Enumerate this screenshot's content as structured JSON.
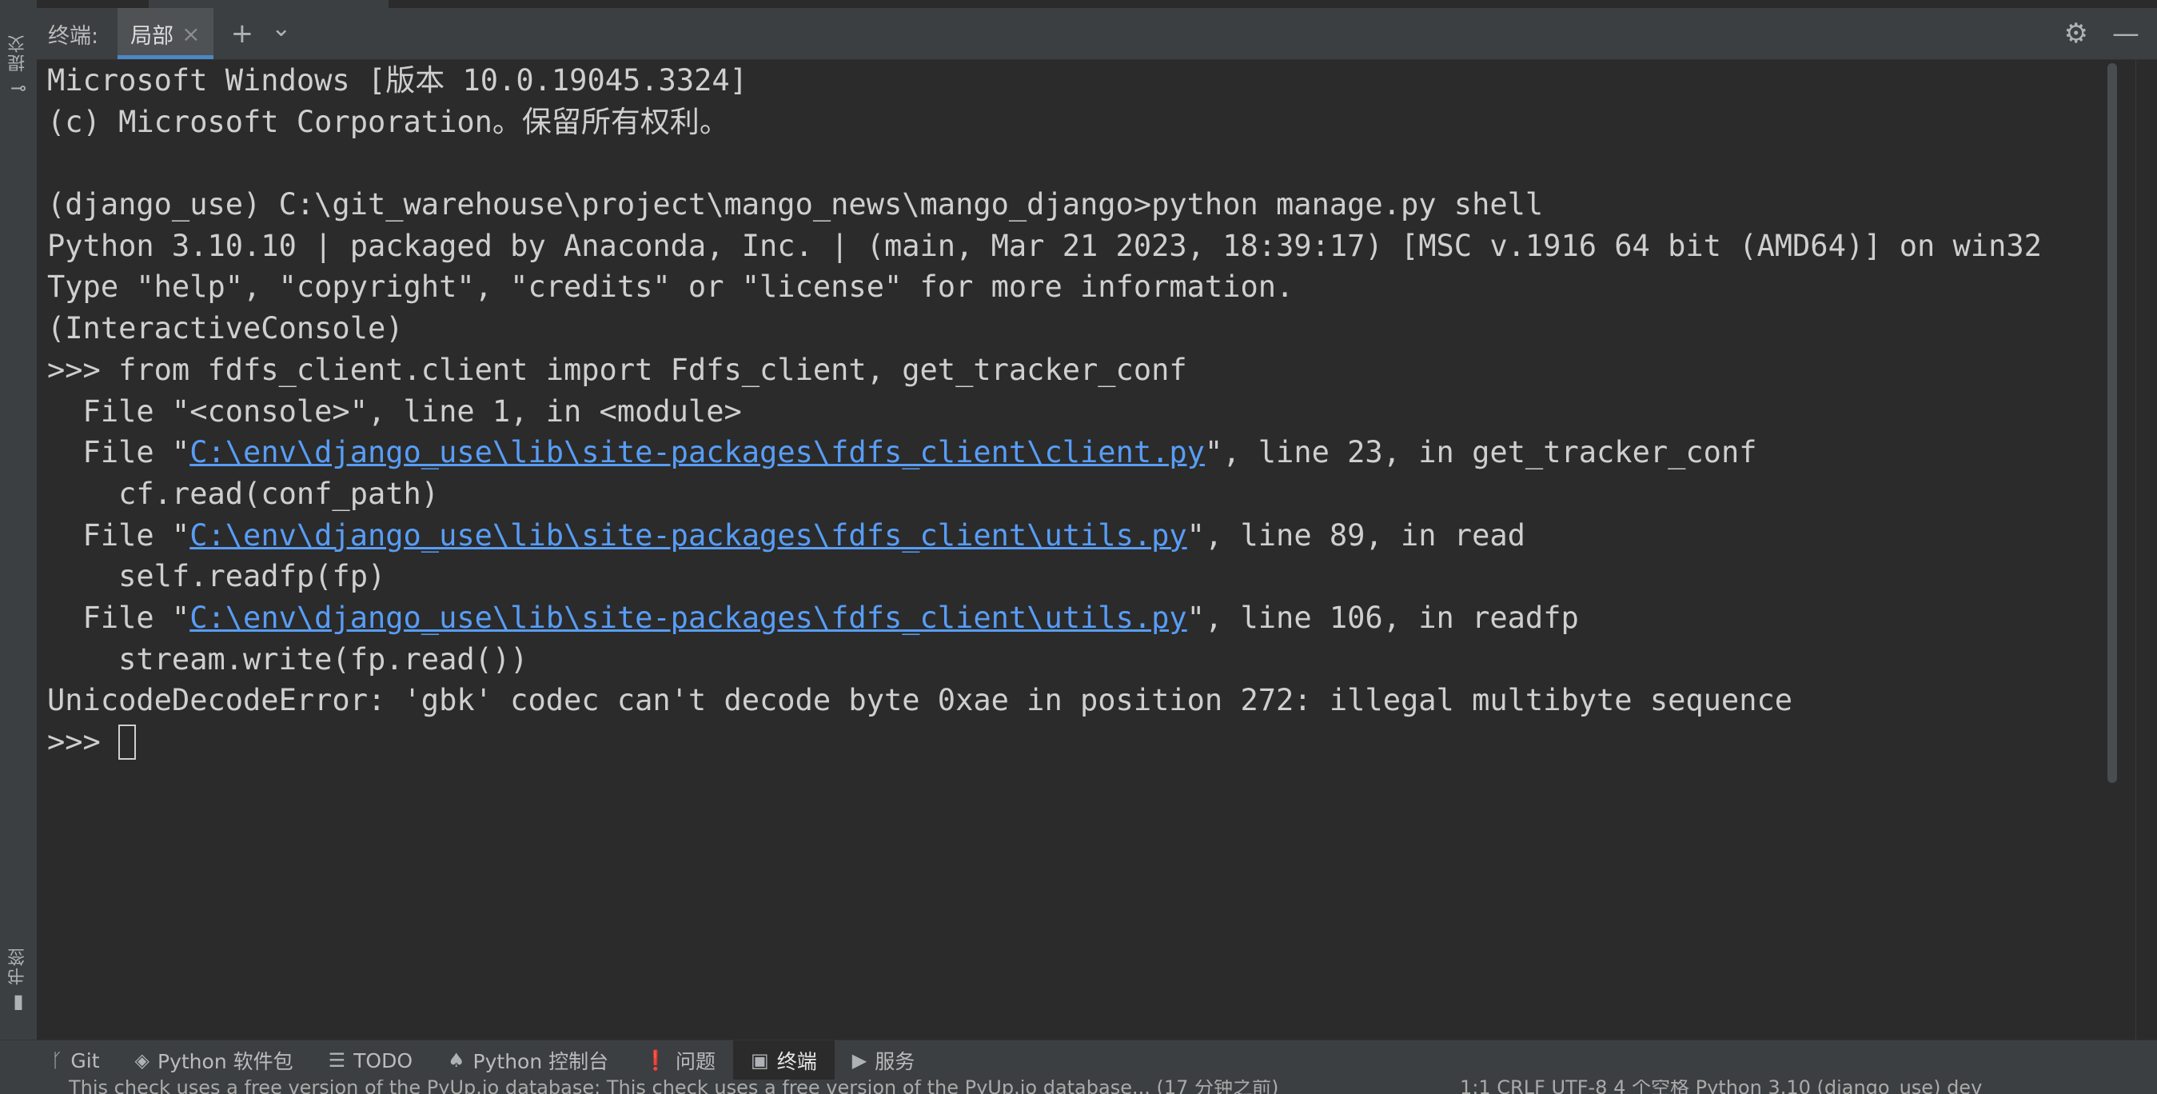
{
  "left_strip": {
    "commit_label": "提交",
    "bookmarks_label": "书签"
  },
  "terminal_header": {
    "title": "终端:",
    "tab_label": "局部",
    "close_glyph": "×",
    "add_glyph": "+",
    "dropdown_glyph": "⌄",
    "settings_glyph": "⚙",
    "minimize_glyph": "—"
  },
  "terminal": {
    "lines": [
      {
        "parts": [
          {
            "text": "Microsoft Windows [版本 10.0.19045.3324]"
          }
        ]
      },
      {
        "parts": [
          {
            "text": "(c) Microsoft Corporation。保留所有权利。"
          }
        ]
      },
      {
        "parts": [
          {
            "text": ""
          }
        ]
      },
      {
        "parts": [
          {
            "text": "(django_use) C:\\git_warehouse\\project\\mango_news\\mango_django>python manage.py shell"
          }
        ]
      },
      {
        "parts": [
          {
            "text": "Python 3.10.10 | packaged by Anaconda, Inc. | (main, Mar 21 2023, 18:39:17) [MSC v.1916 64 bit (AMD64)] on win32"
          }
        ]
      },
      {
        "parts": [
          {
            "text": "Type \"help\", \"copyright\", \"credits\" or \"license\" for more information."
          }
        ]
      },
      {
        "parts": [
          {
            "text": "(InteractiveConsole)"
          }
        ]
      },
      {
        "parts": [
          {
            "text": ">>> from fdfs_client.client import Fdfs_client, get_tracker_conf"
          }
        ]
      },
      {
        "parts": [
          {
            "text": "  File \"<console>\", line 1, in <module>"
          }
        ]
      },
      {
        "parts": [
          {
            "text": "  File \""
          },
          {
            "text": "C:\\env\\django_use\\lib\\site-packages\\fdfs_client\\client.py",
            "link": true
          },
          {
            "text": "\", line 23, in get_tracker_conf"
          }
        ]
      },
      {
        "parts": [
          {
            "text": "    cf.read(conf_path)"
          }
        ]
      },
      {
        "parts": [
          {
            "text": "  File \""
          },
          {
            "text": "C:\\env\\django_use\\lib\\site-packages\\fdfs_client\\utils.py",
            "link": true
          },
          {
            "text": "\", line 89, in read"
          }
        ]
      },
      {
        "parts": [
          {
            "text": "    self.readfp(fp)"
          }
        ]
      },
      {
        "parts": [
          {
            "text": "  File \""
          },
          {
            "text": "C:\\env\\django_use\\lib\\site-packages\\fdfs_client\\utils.py",
            "link": true
          },
          {
            "text": "\", line 106, in readfp"
          }
        ]
      },
      {
        "parts": [
          {
            "text": "    stream.write(fp.read())"
          }
        ]
      },
      {
        "parts": [
          {
            "text": "UnicodeDecodeError: 'gbk' codec can't decode byte 0xae in position 272: illegal multibyte sequence"
          }
        ]
      },
      {
        "parts": [
          {
            "text": ">>> "
          }
        ],
        "cursor": true
      }
    ]
  },
  "tool_bar": {
    "items": [
      {
        "icon": "git-branch-icon",
        "glyph": "ᚴ",
        "label": "Git",
        "active": false
      },
      {
        "icon": "python-packages-icon",
        "glyph": "◈",
        "label": "Python 软件包",
        "active": false
      },
      {
        "icon": "todo-list-icon",
        "glyph": "☰",
        "label": "TODO",
        "active": false
      },
      {
        "icon": "python-console-icon",
        "glyph": "♠",
        "label": "Python 控制台",
        "active": false
      },
      {
        "icon": "problems-icon",
        "glyph": "❗",
        "label": "问题",
        "active": false
      },
      {
        "icon": "terminal-icon",
        "glyph": "▣",
        "label": "终端",
        "active": true
      },
      {
        "icon": "services-icon",
        "glyph": "▶",
        "label": "服务",
        "active": false
      }
    ]
  },
  "status_bar": {
    "message": "This check uses a free version of the PyUp.io database: This check uses a free version of the PyUp.io database... (17 分钟之前)",
    "right": "1:1   CRLF   UTF-8   4 个空格   Python 3.10 (django_use)   dev"
  },
  "colors": {
    "background": "#2b2b2b",
    "panel": "#3c3f41",
    "text": "#cfcfcf",
    "link": "#589df6",
    "tab_underline": "#4a88c7"
  }
}
